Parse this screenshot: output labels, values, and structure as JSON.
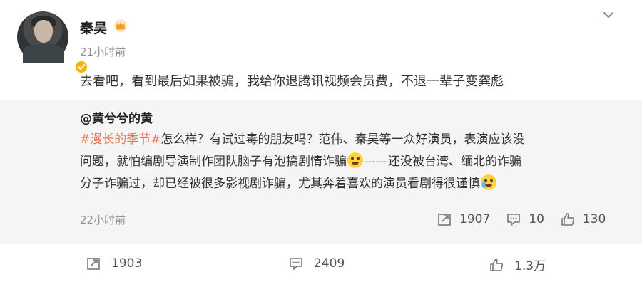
{
  "post": {
    "username": "秦昊",
    "time": "21小时前",
    "content": "去看吧，看到最后如果被骗，我给你退腾讯视频会员费，不退一辈子变龚彪"
  },
  "repost": {
    "author": "@黄兮兮的黄",
    "hashtag": "#漫长的季节#",
    "text_1": "怎么样？有试过毒的朋友吗？范伟、秦昊等一众好演员，表演应该没问题，就怕编剧导演制作团队脑子有泡搞剧情诈骗",
    "text_2": "——还没被台湾、缅北的诈骗分子诈骗过，却已经被很多影视剧诈骗，尤其奔着喜欢的演员看剧得很谨慎",
    "time": "22小时前",
    "repost_count": "1907",
    "comment_count": "10",
    "like_count": "130"
  },
  "actions": {
    "repost_count": "1903",
    "comment_count": "2409",
    "like_count": "1.3万"
  },
  "colors": {
    "hashtag": "#eb7350",
    "verify_badge": "#f7b500",
    "repost_bg": "#f5f5f5",
    "time_gray": "#939393"
  },
  "icons": {
    "header": [
      "crown-icon",
      "verified-badge-icon",
      "chevron-down-icon"
    ],
    "actions": [
      "repost-icon",
      "comment-icon",
      "like-icon"
    ],
    "emoji": [
      "grimace-emoji-icon",
      "crying-emoji-icon"
    ]
  }
}
